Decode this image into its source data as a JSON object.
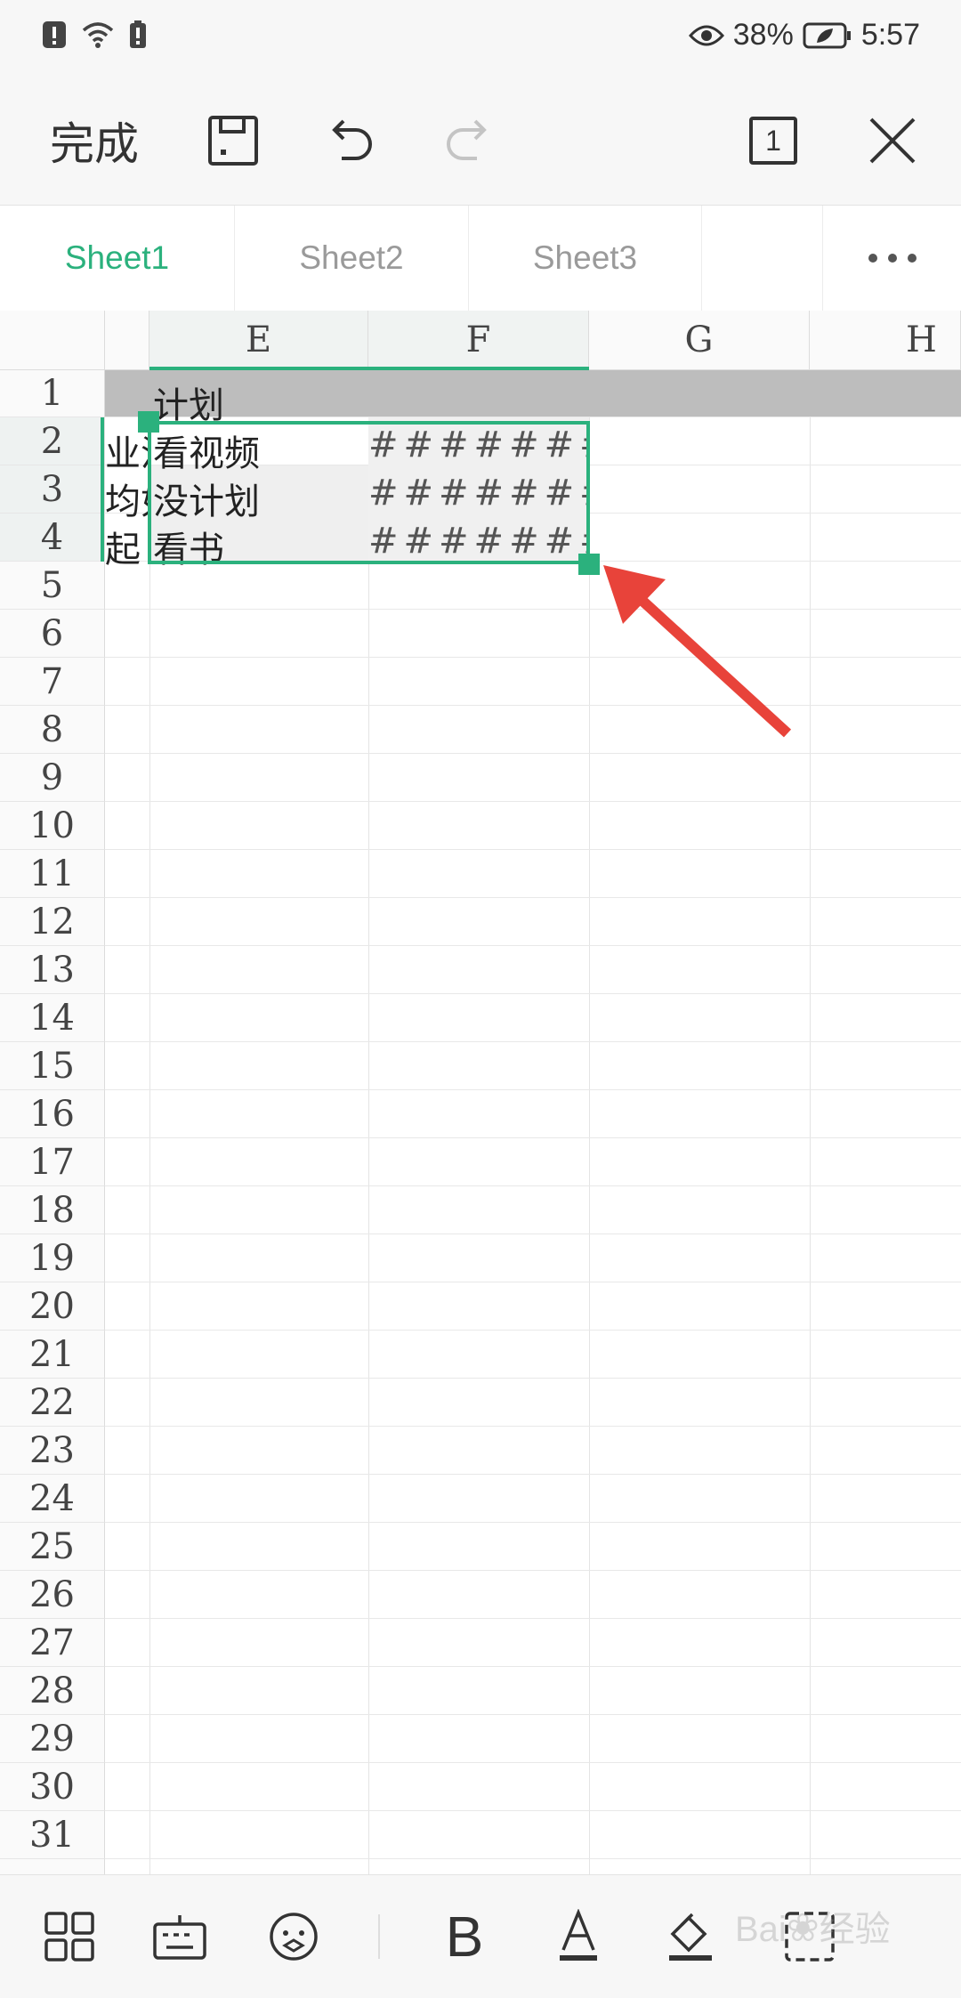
{
  "status_bar": {
    "battery": "38%",
    "time": "5:57"
  },
  "toolbar": {
    "done_label": "完成",
    "page_indicator": "1"
  },
  "tabs": [
    {
      "label": "Sheet1",
      "active": true
    },
    {
      "label": "Sheet2",
      "active": false
    },
    {
      "label": "Sheet3",
      "active": false
    }
  ],
  "sheet": {
    "columns": [
      "E",
      "F",
      "G",
      "H"
    ],
    "rows": [
      "1",
      "2",
      "3",
      "4",
      "5",
      "6",
      "7",
      "8",
      "9",
      "10",
      "11",
      "12",
      "13",
      "14",
      "15",
      "16",
      "17",
      "18",
      "19",
      "20",
      "21",
      "22",
      "23",
      "24",
      "25",
      "26",
      "27",
      "28",
      "29",
      "30",
      "31"
    ],
    "cells": {
      "E1": "计划",
      "D2": "业沿",
      "D3": "均如",
      "D4": "起",
      "E2": "看视频",
      "E3": "没计划",
      "E4": "看书",
      "F2": "#######",
      "F3": "#######",
      "F4": "#######"
    }
  },
  "colors": {
    "accent": "#2bb17d",
    "selection": "#2bb17d",
    "arrow": "#e8433a",
    "header_row_fill": "#bdbdbd"
  },
  "watermark": "Baidu 经验 jingyan.baidu.com"
}
